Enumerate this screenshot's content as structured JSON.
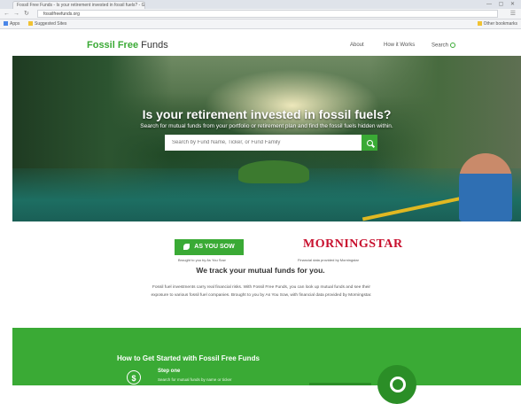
{
  "browser": {
    "tab_title": "Fossil Free Funds - Is your retirement invested in fossil fuels? - Google Chrome",
    "window_controls": "— ▢ ✕",
    "url": "fossilfreefunds.org",
    "bookmarks": [
      {
        "label": "Apps",
        "color": "#4a86e8"
      },
      {
        "label": "Suggested Sites",
        "color": "#f1c232"
      }
    ],
    "other_bookmarks": "Other bookmarks"
  },
  "nav": {
    "logo_part1": "Fossil Free",
    "logo_part2": " Funds",
    "links": [
      "About",
      "How it Works",
      "Search"
    ]
  },
  "hero": {
    "title": "Is your retirement invested in fossil fuels?",
    "subtitle": "Search for mutual funds from your portfolio or retirement plan and find the fossil fuels hidden within.",
    "search_placeholder": "Search by Fund Name, Ticker, or Fund Family"
  },
  "partners": {
    "ays_label": "AS YOU SOW",
    "ays_caption": "Brought to you by As You Sow",
    "ms_label": "MORNINGSTAR",
    "ms_caption": "Financial data provided by Morningstar"
  },
  "track": {
    "title": "We track your mutual funds for you.",
    "body": "Fossil fuel investments carry real financial risks. With Fossil Free Funds, you can look up mutual funds and see their exposure to various fossil fuel companies. Brought to you by As You Sow, with financial data provided by Morningstar."
  },
  "get_started": {
    "title": "How to Get Started with Fossil Free Funds",
    "step_label": "Step one",
    "step_text": "Search for mutual funds by name or ticker"
  },
  "colors": {
    "brand_green": "#3aaa35",
    "morningstar_red": "#c8102e"
  }
}
